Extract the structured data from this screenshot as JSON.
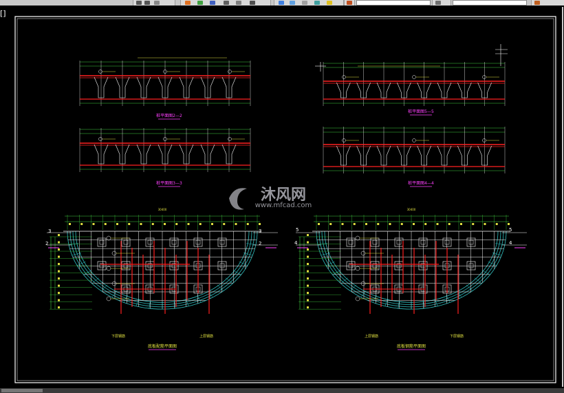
{
  "viewport": {
    "tab_label": "[]"
  },
  "drawing": {
    "section_titles": {
      "s2": "桩平面图2—2",
      "s3": "桩平面图3—3",
      "s5": "桩平面图5—5",
      "s4": "桩平面图4—4"
    },
    "plan_titles": {
      "left": "底板配筋平面图",
      "right": "底板钢筋平面图"
    },
    "plan_sub_labels": {
      "left_a": "下层钢筋",
      "left_b": "上层钢筋",
      "right_a": "上层钢筋",
      "right_b": "下层钢筋"
    },
    "callouts": {
      "rebar_main": "①Φ12@200",
      "rebar_sec": "②Φ12@200"
    },
    "dims": {
      "d1760": "1760",
      "d1700": "1700",
      "d600": "600",
      "overall": "30400"
    },
    "section_marks": {
      "m2": "2",
      "m3": "3",
      "m4": "4",
      "m5": "5"
    }
  },
  "watermark": {
    "cn": "沐风网",
    "url": "www.mfcad.com"
  },
  "colors": {
    "bg": "#000000",
    "frame": "#ffffff",
    "red": "#ff2020",
    "green": "#40d040",
    "cyan": "#30c0c0",
    "yellow": "#e0e040",
    "magenta": "#ff40ff"
  }
}
